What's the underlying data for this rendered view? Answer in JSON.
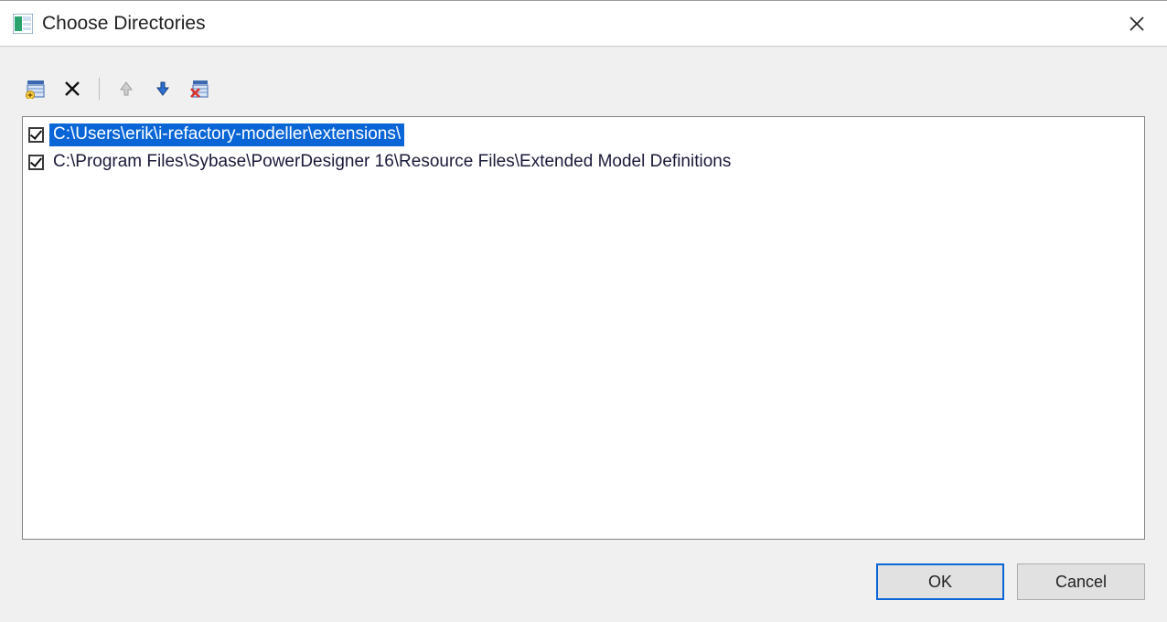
{
  "window": {
    "title": "Choose Directories"
  },
  "toolbar": {
    "icons": {
      "add": "add-directory-icon",
      "remove": "remove-x-icon",
      "move_up": "arrow-up-icon",
      "move_down": "arrow-down-icon",
      "remove_invalid": "remove-invalid-icon"
    }
  },
  "directories": [
    {
      "checked": true,
      "selected": true,
      "path": "C:\\Users\\erik\\i-refactory-modeller\\extensions\\"
    },
    {
      "checked": true,
      "selected": false,
      "path": "C:\\Program Files\\Sybase\\PowerDesigner 16\\Resource Files\\Extended Model Definitions"
    }
  ],
  "buttons": {
    "ok": "OK",
    "cancel": "Cancel"
  }
}
